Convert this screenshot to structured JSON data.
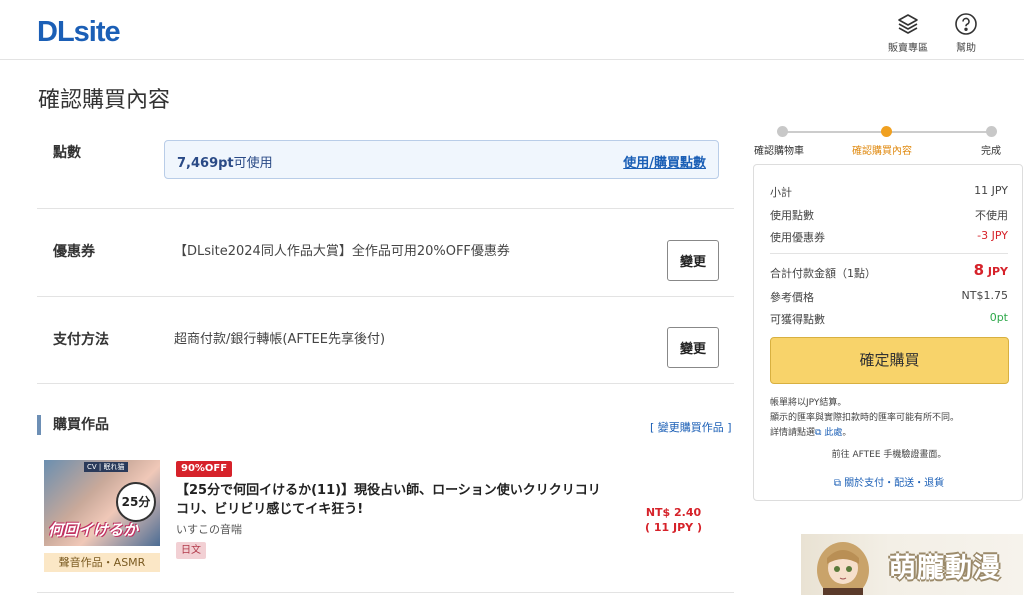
{
  "header": {
    "logo": "DLsite",
    "sales_label": "販賣專區",
    "help_label": "幫助"
  },
  "page_title": "確認購買內容",
  "points": {
    "label": "點數",
    "amount": "7,469pt",
    "available_suffix": "可使用",
    "link": "使用/購買點數"
  },
  "coupon": {
    "label": "優惠券",
    "text": "【DLsite2024同人作品大賞】全作品可用20%OFF優惠券",
    "button": "變更"
  },
  "payment": {
    "label": "支付方法",
    "text": "超商付款/銀行轉帳(AFTEE先享後付)",
    "button": "變更"
  },
  "works": {
    "heading": "購買作品",
    "change_link": "[ 變更購買作品 ]",
    "items": [
      {
        "discount": "90%OFF",
        "title": "【25分で何回イけるか(11)】現役占い師、ローション使いクリクリコリコリ、ビリビリ感じてイキ狂う!",
        "circle": "いすこの音喘",
        "language": "日文",
        "category": "聲音作品・ASMR",
        "price_ntd": "NT$ 2.40",
        "price_jpy": "( 11 JPY )"
      }
    ]
  },
  "steps": [
    {
      "label": "確認購物車",
      "active": false
    },
    {
      "label": "確認購買內容",
      "active": true
    },
    {
      "label": "完成",
      "active": false
    }
  ],
  "summary": {
    "subtotal_label": "小計",
    "subtotal_value": "11 JPY",
    "points_label": "使用點數",
    "points_value": "不使用",
    "coupon_label": "使用優惠券",
    "coupon_value": "-3 JPY",
    "total_label": "合計付款金額（1點）",
    "total_number": "8",
    "total_unit": " JPY",
    "ref_label": "參考價格",
    "ref_value": "NT$1.75",
    "earn_label": "可獲得點數",
    "earn_value": "0pt",
    "buy_button": "確定購買",
    "note_line1": "帳單將以JPY結算。",
    "note_line2": "顯示的匯率與實際扣款時的匯率可能有所不同。",
    "note_line3_prefix": "詳情請點選",
    "note_line3_link": "此處",
    "note_line3_suffix": "。",
    "aftee_note": "前往 AFTEE 手機驗證畫面。",
    "policy_link": "關於支付・配送・退貨"
  },
  "watermark_text": "萌朧動漫",
  "colors": {
    "brand": "#1b5fb6",
    "accent_orange": "#f0a020",
    "price_red": "#d6222a",
    "buy_button": "#f8d36a"
  }
}
